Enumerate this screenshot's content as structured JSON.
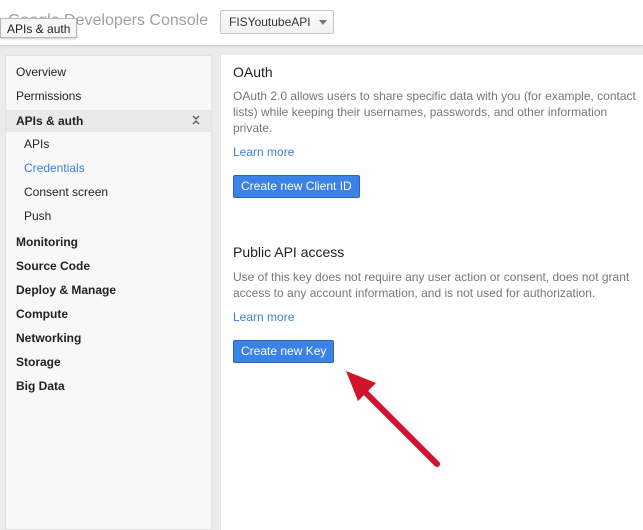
{
  "header": {
    "brand": "Google Developers Console",
    "project_selector": "FISYoutubeAPI",
    "tooltip": "APIs & auth"
  },
  "sidebar": {
    "items": [
      {
        "label": "Overview"
      },
      {
        "label": "Permissions"
      },
      {
        "label": "APIs & auth"
      },
      {
        "label": "APIs"
      },
      {
        "label": "Credentials"
      },
      {
        "label": "Consent screen"
      },
      {
        "label": "Push"
      },
      {
        "label": "Monitoring"
      },
      {
        "label": "Source Code"
      },
      {
        "label": "Deploy & Manage"
      },
      {
        "label": "Compute"
      },
      {
        "label": "Networking"
      },
      {
        "label": "Storage"
      },
      {
        "label": "Big Data"
      }
    ],
    "selected": "Credentials"
  },
  "oauth": {
    "title": "OAuth",
    "description": "OAuth 2.0 allows users to share specific data with you (for example, contact lists) while keeping their usernames, passwords, and other information private.",
    "learn_more": "Learn more",
    "button": "Create new Client ID"
  },
  "public_api": {
    "title": "Public API access",
    "description": "Use of this key does not require any user action or consent, does not grant access to any account information, and is not used for authorization.",
    "learn_more": "Learn more",
    "button": "Create new Key"
  },
  "colors": {
    "accent": "#3d7ed8",
    "button": "#3b82e6",
    "annotation_arrow": "#d0142c"
  },
  "icons": {
    "collapse": "collapse-chevrons-icon",
    "dropdown": "chevron-down-icon",
    "annotation": "red-arrow-icon"
  }
}
